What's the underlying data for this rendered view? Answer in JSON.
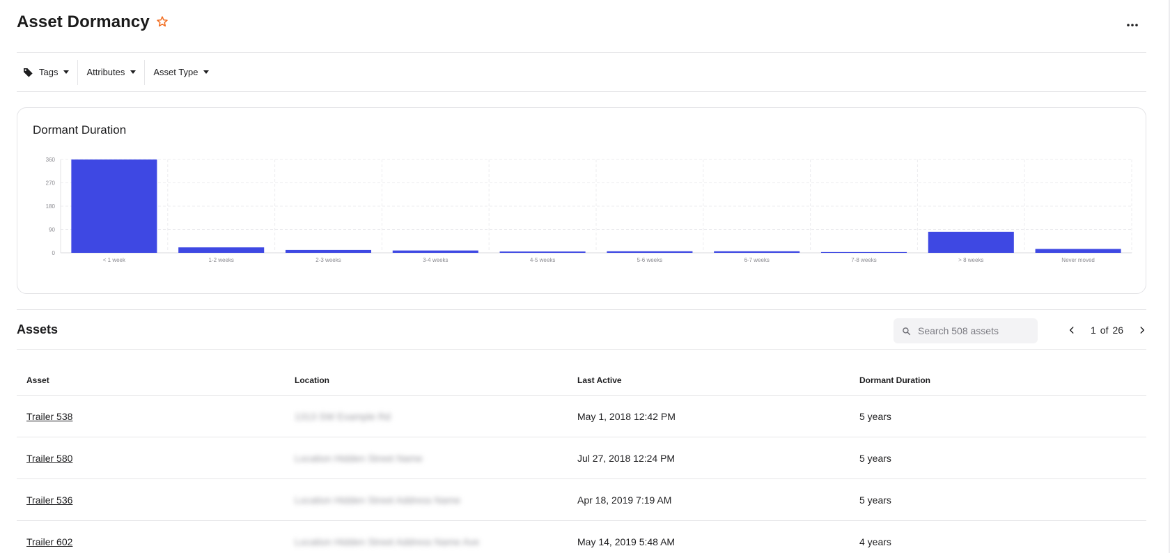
{
  "header": {
    "title": "Asset Dormancy",
    "favorite_icon": "star-outline-icon",
    "more_icon": "more-horizontal-icon",
    "accent_color": "#f26b1d"
  },
  "filters": [
    {
      "label": "Tags",
      "icon": "tag-icon"
    },
    {
      "label": "Attributes"
    },
    {
      "label": "Asset Type"
    }
  ],
  "chart_card": {
    "title": "Dormant Duration"
  },
  "chart_data": {
    "type": "bar",
    "title": "Dormant Duration",
    "categories": [
      "< 1 week",
      "1-2 weeks",
      "2-3 weeks",
      "3-4 weeks",
      "4-5 weeks",
      "5-6 weeks",
      "6-7 weeks",
      "7-8 weeks",
      "> 8 weeks",
      "Never moved"
    ],
    "values": [
      360,
      21,
      11,
      9,
      5,
      6,
      6,
      3,
      81,
      15
    ],
    "yticks": [
      0,
      90,
      180,
      270,
      360
    ],
    "ylim": [
      0,
      360
    ],
    "grid": true,
    "bar_color": "#3e48e3"
  },
  "assets": {
    "title": "Assets",
    "search_placeholder": "Search 508 assets",
    "search_icon": "search-icon",
    "pagination": {
      "current": "1",
      "of": "of",
      "total": "26",
      "prev_icon": "chevron-left-icon",
      "next_icon": "chevron-right-icon"
    },
    "columns": [
      "Asset",
      "Location",
      "Last Active",
      "Dormant Duration"
    ],
    "rows": [
      {
        "asset": "Trailer 538",
        "location": "1313 SW Example Rd",
        "last_active": "May 1, 2018 12:42 PM",
        "duration": "5 years"
      },
      {
        "asset": "Trailer 580",
        "location": "Location Hidden Street Name",
        "last_active": "Jul 27, 2018 12:24 PM",
        "duration": "5 years"
      },
      {
        "asset": "Trailer 536",
        "location": "Location Hidden Street Address Name",
        "last_active": "Apr 18, 2019 7:19 AM",
        "duration": "5 years"
      },
      {
        "asset": "Trailer 602",
        "location": "Location Hidden Street Address Name Ave",
        "last_active": "May 14, 2019 5:48 AM",
        "duration": "4 years"
      }
    ]
  }
}
